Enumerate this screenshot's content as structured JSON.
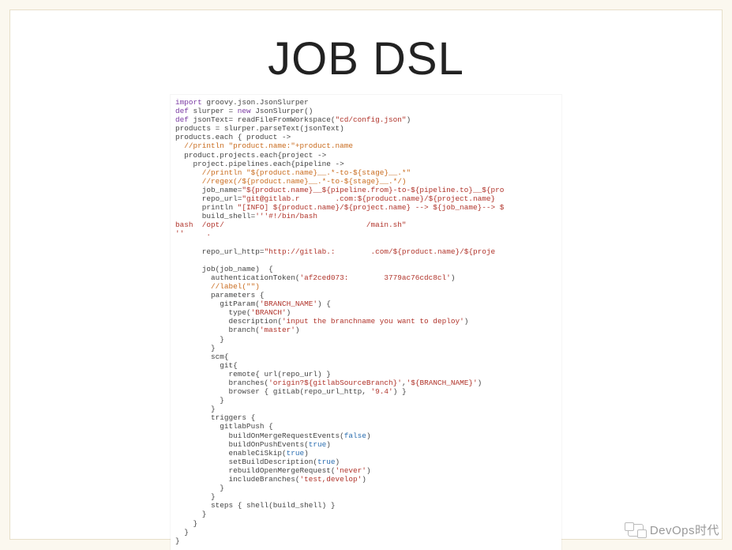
{
  "title": "JOB DSL",
  "watermark": "DevOps时代",
  "code": {
    "l01_a": "import",
    "l01_b": " groovy.json.JsonSlurper",
    "l02_a": "def",
    "l02_b": " slurper = ",
    "l02_c": "new",
    "l02_d": " JsonSlurper()",
    "l03_a": "def",
    "l03_b": " jsonText= readFileFromWorkspace(",
    "l03_c": "\"cd/config.json\"",
    "l03_d": ")",
    "l04": "products = slurper.parseText(jsonText)",
    "l05": "products.each { product ->",
    "l06": "  //println \"product.name:\"+product.name",
    "l07": "  product.projects.each{project ->",
    "l08": "    project.pipelines.each{pipeline ->",
    "l09": "      //println \"${product.name}__.*-to-${stage}__.*\"",
    "l10": "      //regex(/${product.name}__.*-to-${stage}__.*/)",
    "l11_a": "      job_name=",
    "l11_b": "\"${product.name}__${pipeline.from}-to-${pipeline.to}__${pro",
    "l12_a": "      repo_url=",
    "l12_b": "\"git@gitlab.r        .com:${product.name}/${project.name}",
    "l13_a": "      println ",
    "l13_b": "\"[INFO] ${product.name}/${project.name} --> ${job_name}--> $",
    "l14_a": "      build_shell=",
    "l14_b": "'''#!/bin/bash",
    "l15_a": "bash  /opt/                                /main.sh\"",
    "l15_b": "''     .",
    "l16": "",
    "l17_a": "      repo_url_http=",
    "l17_b": "\"http://gitlab.:        .com/${product.name}/${proje",
    "l18": "",
    "l19": "      job(job_name)  {",
    "l20_a": "        authenticationToken(",
    "l20_b": "'af2ced073:        3779ac76cdc8cl'",
    "l20_c": ")",
    "l21": "        //label(\"\")",
    "l22": "        parameters {",
    "l23_a": "          gitParam(",
    "l23_b": "'BRANCH_NAME'",
    "l23_c": ") {",
    "l24_a": "            type(",
    "l24_b": "'BRANCH'",
    "l24_c": ")",
    "l25_a": "            description(",
    "l25_b": "'input the branchname you want to deploy'",
    "l25_c": ")",
    "l26_a": "            branch(",
    "l26_b": "'master'",
    "l26_c": ")",
    "l27": "          }",
    "l28": "        }",
    "l29": "        scm{",
    "l30": "          git{",
    "l31": "            remote{ url(repo_url) }",
    "l32_a": "            branches(",
    "l32_b": "'origin?${gitlabSourceBranch}'",
    "l32_c": ",",
    "l32_d": "'${BRANCH_NAME}'",
    "l32_e": ")",
    "l33_a": "            browser { gitLab(repo_url_http, ",
    "l33_b": "'9.4'",
    "l33_c": ") }",
    "l34": "          }",
    "l35": "        }",
    "l36": "        triggers {",
    "l37": "          gitlabPush {",
    "l38_a": "            buildOnMergeRequestEvents(",
    "l38_b": "false",
    "l38_c": ")",
    "l39_a": "            buildOnPushEvents(",
    "l39_b": "true",
    "l39_c": ")",
    "l40_a": "            enableCiSkip(",
    "l40_b": "true",
    "l40_c": ")",
    "l41_a": "            setBuildDescription(",
    "l41_b": "true",
    "l41_c": ")",
    "l42_a": "            rebuildOpenMergeRequest(",
    "l42_b": "'never'",
    "l42_c": ")",
    "l43_a": "            includeBranches(",
    "l43_b": "'test,develop'",
    "l43_c": ")",
    "l44": "          }",
    "l45": "        }",
    "l46": "        steps { shell(build_shell) }",
    "l47": "      }",
    "l48": "    }",
    "l49": "  }",
    "l50": "}"
  }
}
